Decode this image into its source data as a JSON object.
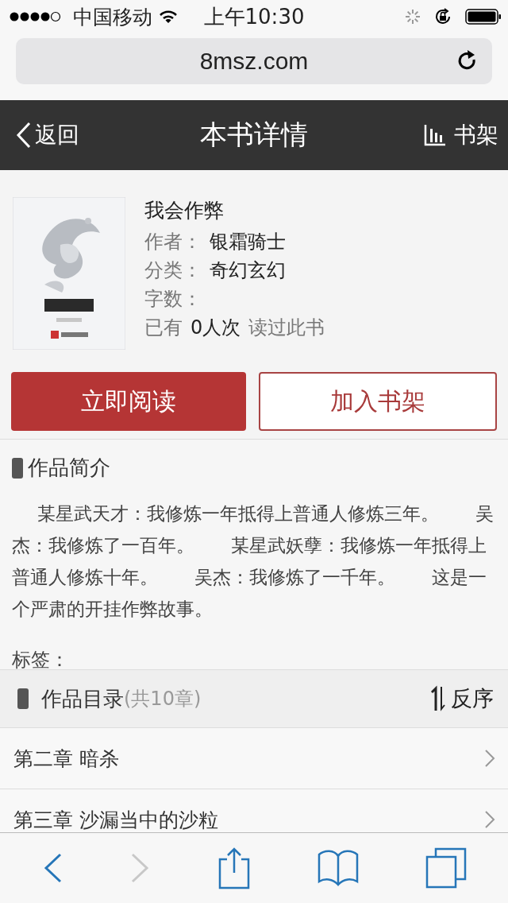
{
  "status_bar": {
    "carrier": "中国移动",
    "time": "上午10:30"
  },
  "browser": {
    "url": "8msz.com"
  },
  "nav": {
    "back": "返回",
    "title": "本书详情",
    "shelf": "书架"
  },
  "book": {
    "title": "我会作弊",
    "fields": [
      {
        "label": "作者：",
        "value": "银霜骑士"
      },
      {
        "label": "分类：",
        "value": "奇幻玄幻"
      },
      {
        "label": "字数："
      }
    ],
    "readers": {
      "prefix": "已有",
      "count": "0人次",
      "suffix": "读过此书"
    }
  },
  "actions": [
    {
      "label": "立即阅读",
      "kind": "primary"
    },
    {
      "label": "加入书架",
      "kind": "outline"
    }
  ],
  "intro": {
    "heading": "作品简介",
    "text": "某星武天才：我修炼一年抵得上普通人修炼三年。　　吴杰：我修炼了一百年。　　某星武妖孽：我修炼一年抵得上普通人修炼十年。　　吴杰：我修炼了一千年。　　这是一个严肃的开挂作弊故事。"
  },
  "tags": {
    "label": "标签："
  },
  "catalog": {
    "heading": "作品目录",
    "count": "(共10章)",
    "sort": "反序"
  },
  "chapters": [
    "第二章 暗杀",
    "第三章 沙漏当中的沙粒"
  ],
  "toolbar": [
    {
      "kind": "back",
      "disabled": false
    },
    {
      "kind": "forward",
      "disabled": true
    },
    {
      "kind": "share",
      "disabled": false
    },
    {
      "kind": "bookmarks",
      "disabled": false
    },
    {
      "kind": "tabs",
      "disabled": false
    }
  ]
}
